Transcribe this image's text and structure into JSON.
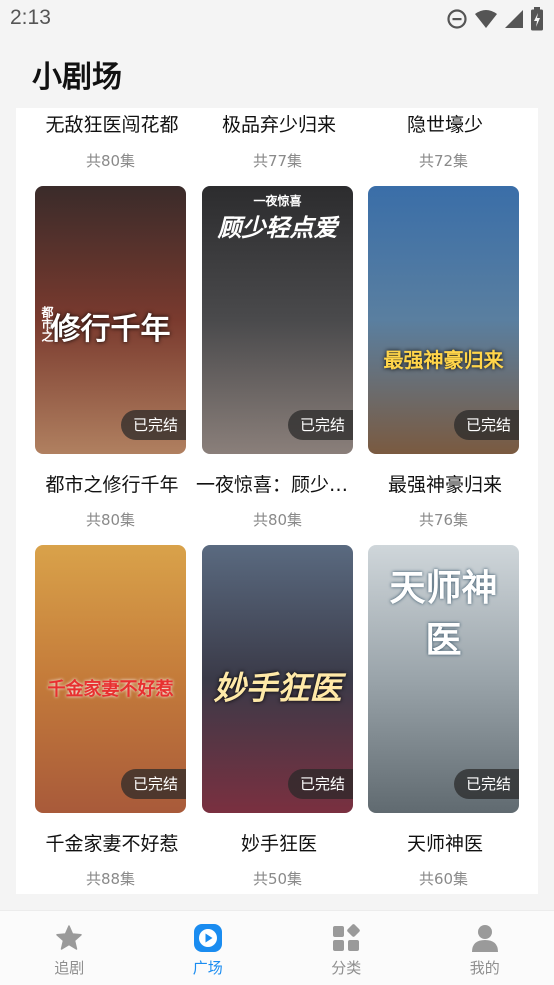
{
  "status_bar": {
    "time": "2:13"
  },
  "header": {
    "title": "小剧场"
  },
  "badge_label": "已完结",
  "top_row": [
    {
      "title": "无敌狂医闯花都",
      "episodes": "共80集"
    },
    {
      "title": "极品弃少归来",
      "episodes": "共77集"
    },
    {
      "title": "隐世壕少",
      "episodes": "共72集"
    }
  ],
  "dramas": [
    {
      "title": "都市之修行千年",
      "episodes": "共80集",
      "art_text": "修行千年",
      "art_sub": "都市之",
      "colors": [
        "#3a2b2a",
        "#7a3a2e",
        "#b08060"
      ]
    },
    {
      "title": "一夜惊喜：顾少轻点爱",
      "episodes": "共80集",
      "art_text": "顾少轻点爱",
      "art_sub": "一夜惊喜",
      "colors": [
        "#2c2c2e",
        "#4a4a4c",
        "#8a7f7a"
      ]
    },
    {
      "title": "最强神豪归来",
      "episodes": "共76集",
      "art_text": "最强神豪归来",
      "art_sub": "",
      "colors": [
        "#3a6ea8",
        "#5a7fa0",
        "#7a5a40"
      ]
    },
    {
      "title": "千金家妻不好惹",
      "episodes": "共88集",
      "art_text": "千金家妻不好惹",
      "art_sub": "",
      "colors": [
        "#d9a24a",
        "#c47b3a",
        "#a85a3a"
      ]
    },
    {
      "title": "妙手狂医",
      "episodes": "共50集",
      "art_text": "妙手狂医",
      "art_sub": "",
      "colors": [
        "#5a6a80",
        "#3a3a48",
        "#7a3040"
      ]
    },
    {
      "title": "天师神医",
      "episodes": "共60集",
      "art_text": "天师神医",
      "art_sub": "",
      "colors": [
        "#cfd6da",
        "#9aa4aa",
        "#606a70"
      ]
    }
  ],
  "bottom_nav": [
    {
      "label": "追剧",
      "icon": "star-icon",
      "active": false
    },
    {
      "label": "广场",
      "icon": "play-icon",
      "active": true
    },
    {
      "label": "分类",
      "icon": "category-icon",
      "active": false
    },
    {
      "label": "我的",
      "icon": "user-icon",
      "active": false
    }
  ],
  "colors": {
    "accent": "#1a8cf0",
    "inactive": "#8f8f8f"
  }
}
